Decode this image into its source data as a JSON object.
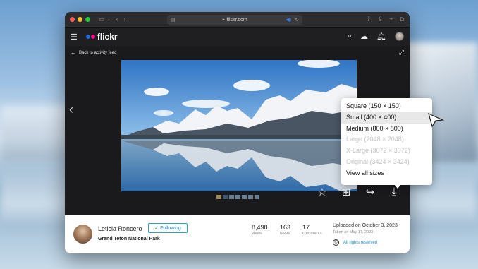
{
  "browser": {
    "url": "flickr.com"
  },
  "site": {
    "logo_text": "flickr"
  },
  "photo_page": {
    "back_link": "Back to activity feed"
  },
  "owner": {
    "name": "Leticia Roncero",
    "follow_label": "Following",
    "location": "Grand Teton National Park"
  },
  "stats": {
    "views": {
      "value": "8,498",
      "label": "views"
    },
    "faves": {
      "value": "163",
      "label": "faves"
    },
    "comments": {
      "value": "17",
      "label": "comments"
    }
  },
  "meta": {
    "uploaded": "Uploaded on October 3, 2023",
    "taken": "Taken on May 17, 2023",
    "rights": "All rights reserved"
  },
  "download_menu": {
    "items": [
      {
        "label": "Square (150 × 150)",
        "enabled": true
      },
      {
        "label": "Small (400 × 400)",
        "enabled": true,
        "hovered": true
      },
      {
        "label": "Medium (800 × 800)",
        "enabled": true
      },
      {
        "label": "Large (2048 × 2048)",
        "enabled": false
      },
      {
        "label": "X-Large (3072 × 3072)",
        "enabled": false
      },
      {
        "label": "Original (3424 × 3424)",
        "enabled": false
      },
      {
        "label": "View all sizes",
        "enabled": true
      }
    ]
  },
  "icons": {
    "titlebar": [
      "sidebar-icon",
      "back-icon",
      "forward-icon",
      "download-icon",
      "share-icon",
      "new-tab-icon",
      "tabs-icon"
    ],
    "navbar": [
      "menu-icon",
      "search-icon",
      "upload-cloud-icon",
      "bell-icon"
    ],
    "actions": [
      "star-icon",
      "add-to-album-icon",
      "share-icon",
      "download-icon"
    ]
  },
  "colors": {
    "flickr_blue": "#1a6bdc",
    "flickr_pink": "#ff0084",
    "follow_accent": "#2aa2d9",
    "link": "#1d8ac0"
  }
}
